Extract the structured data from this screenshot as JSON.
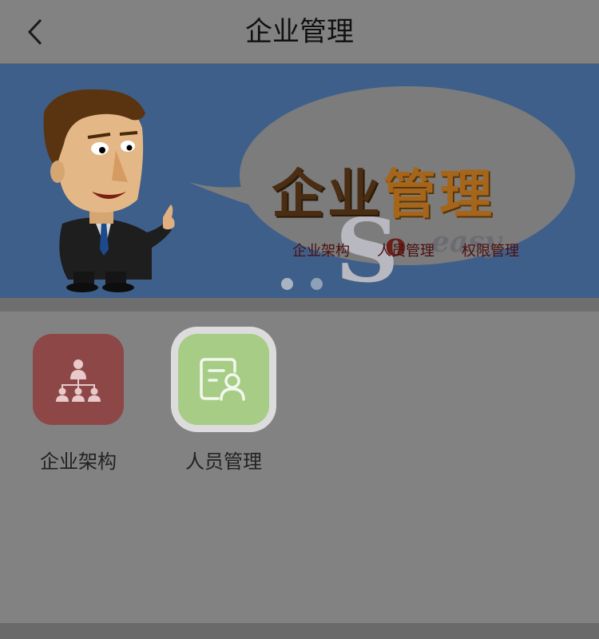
{
  "header": {
    "title": "企业管理",
    "back_icon": "chevron-left-icon"
  },
  "banner": {
    "title_part1": "企业",
    "title_part2": "管理",
    "links": [
      "企业架构",
      "人员管理",
      "权限管理"
    ],
    "slogan_big": "S",
    "slogan_o": "o",
    "slogan_rest": "easy",
    "carousel": {
      "count": 2,
      "active": 0
    }
  },
  "tiles": [
    {
      "label": "企业架构",
      "icon": "org-chart-icon",
      "color": "#8d4747"
    },
    {
      "label": "人员管理",
      "icon": "person-card-icon",
      "color": "#a6cc86"
    }
  ],
  "colors": {
    "banner_bg": "#3f5f8b",
    "page_bg": "#828282"
  }
}
